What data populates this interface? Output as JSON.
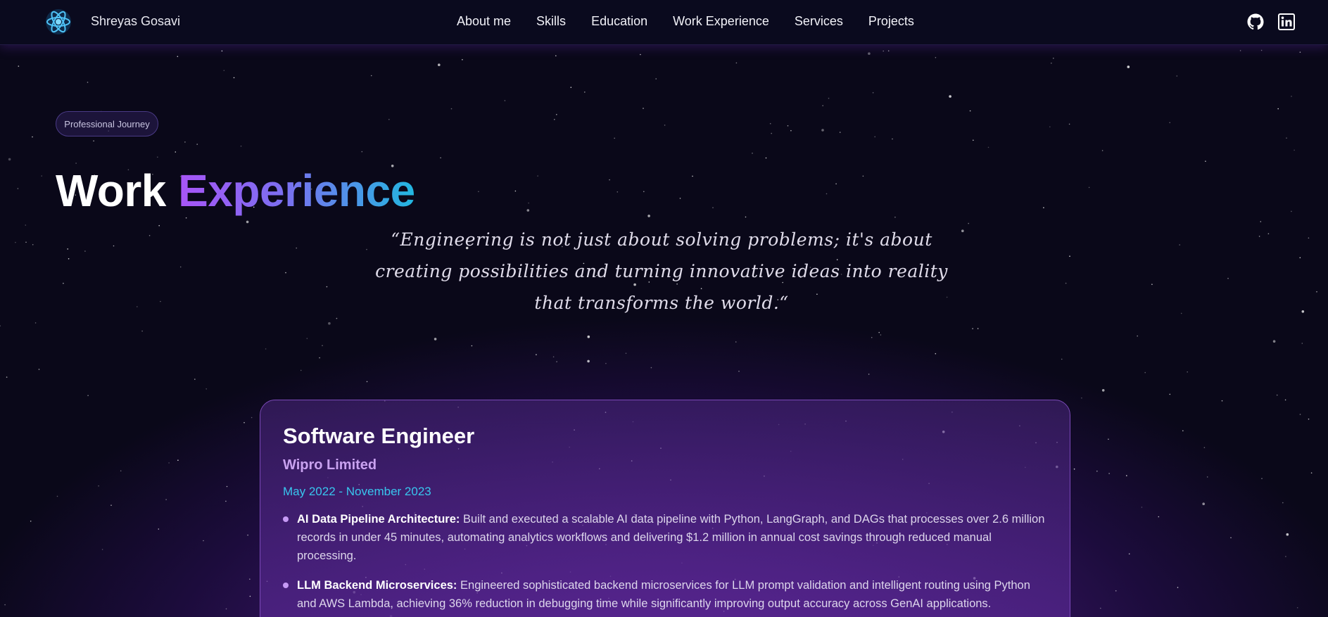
{
  "navbar": {
    "brand": "Shreyas Gosavi",
    "logo_icon": "atom-logo-icon",
    "links": [
      "About me",
      "Skills",
      "Education",
      "Work Experience",
      "Services",
      "Projects"
    ],
    "social": [
      "github-icon",
      "linkedin-icon"
    ]
  },
  "section": {
    "badge": "Professional Journey",
    "title_part1": "Work",
    "title_part2": "Experience",
    "quote": "“Engineering is not just about solving problems; it's about creating possibilities and turning innovative ideas into reality that transforms the world.“"
  },
  "experience": {
    "title": "Software Engineer",
    "company": "Wipro Limited",
    "dates": "May 2022 - November 2023",
    "bullets": [
      {
        "heading": "AI Data Pipeline Architecture:",
        "text": "Built and executed a scalable AI data pipeline with Python, LangGraph, and DAGs that processes over 2.6 million records in under 45 minutes, automating analytics workflows and delivering $1.2 million in annual cost savings through reduced manual processing."
      },
      {
        "heading": "LLM Backend Microservices:",
        "text": "Engineered sophisticated backend microservices for LLM prompt validation and intelligent routing using Python and AWS Lambda, achieving 36% reduction in debugging time while significantly improving output accuracy across GenAI applications."
      }
    ]
  },
  "colors": {
    "background": "#0a0819",
    "accent_purple": "#a855f7",
    "accent_cyan": "#22b7e0",
    "company": "#c9a2f0",
    "dates": "#38c6ee"
  }
}
